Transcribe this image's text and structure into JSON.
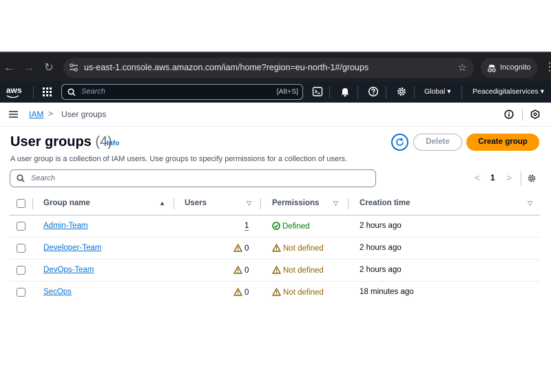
{
  "browser": {
    "url": "us-east-1.console.aws.amazon.com/iam/home?region=eu-north-1#/groups",
    "incognito_label": "Incognito"
  },
  "aws_nav": {
    "logo_text": "aws",
    "search_placeholder": "Search",
    "search_shortcut": "[Alt+S]",
    "region": "Global ▾",
    "account": "Peacedigitalservices ▾"
  },
  "breadcrumb": {
    "service": "IAM",
    "separator": ">",
    "current": "User groups"
  },
  "page": {
    "title": "User groups",
    "count": "(4)",
    "info_label": "Info",
    "description": "A user group is a collection of IAM users. Use groups to specify permissions for a collection of users.",
    "delete_label": "Delete",
    "create_label": "Create group",
    "filter_placeholder": "Search",
    "pager_prev": "<",
    "current_page": "1",
    "pager_next": ">"
  },
  "table": {
    "headers": {
      "group_name": "Group name",
      "users": "Users",
      "permissions": "Permissions",
      "creation_time": "Creation time"
    },
    "sort_asc": "▲",
    "sort_desc": "▽",
    "rows": [
      {
        "group_name": "Admin-Team",
        "users": "1",
        "permissions": "Defined",
        "creation_time": "2 hours ago"
      },
      {
        "group_name": "Developer-Team",
        "users": "0",
        "permissions": "Not defined",
        "creation_time": "2 hours ago"
      },
      {
        "group_name": "DevOps-Team",
        "users": "0",
        "permissions": "Not defined",
        "creation_time": "2 hours ago"
      },
      {
        "group_name": "SecOps",
        "users": "0",
        "permissions": "Not defined",
        "creation_time": "18 minutes ago"
      }
    ]
  },
  "colors": {
    "accent_blue": "#0972d3",
    "create_orange": "#ff9900",
    "success_green": "#037f0c",
    "warning_brown": "#8d6605",
    "nav_dark": "#161d26"
  }
}
